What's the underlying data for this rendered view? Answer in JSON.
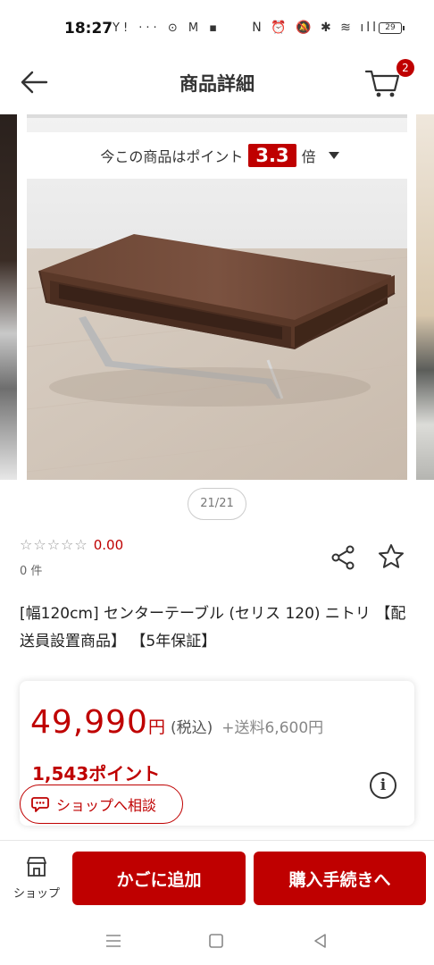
{
  "status_bar": {
    "time": "18:27",
    "left_icons": "Y! ··· ⊙ M ▪",
    "right_icons": "N ⏰ 🔕 ✱ ≋ ıll",
    "battery": "29"
  },
  "header": {
    "title": "商品詳細",
    "cart_count": "2"
  },
  "carousel": {
    "points_prefix": "今この商品はポイント",
    "points_rate": "3.3",
    "points_suffix": "倍",
    "counter": "21/21"
  },
  "rating": {
    "stars": "☆☆☆☆☆",
    "value": "0.00",
    "count": "0 件"
  },
  "product": {
    "title": "[幅120cm] センターテーブル (セリス 120) ニトリ 【配送員設置商品】 【5年保証】"
  },
  "price": {
    "amount": "49,990",
    "unit": "円",
    "tax": "(税込)",
    "shipping": "+送料6,600円",
    "points": "1,543ポイント",
    "info_icon": "i"
  },
  "consult": {
    "label": "ショップへ相談"
  },
  "action_bar": {
    "shop_label": "ショップ",
    "add_to_cart": "かごに追加",
    "purchase": "購入手続きへ"
  },
  "colors": {
    "accent": "#bf0000",
    "text": "#222222"
  }
}
